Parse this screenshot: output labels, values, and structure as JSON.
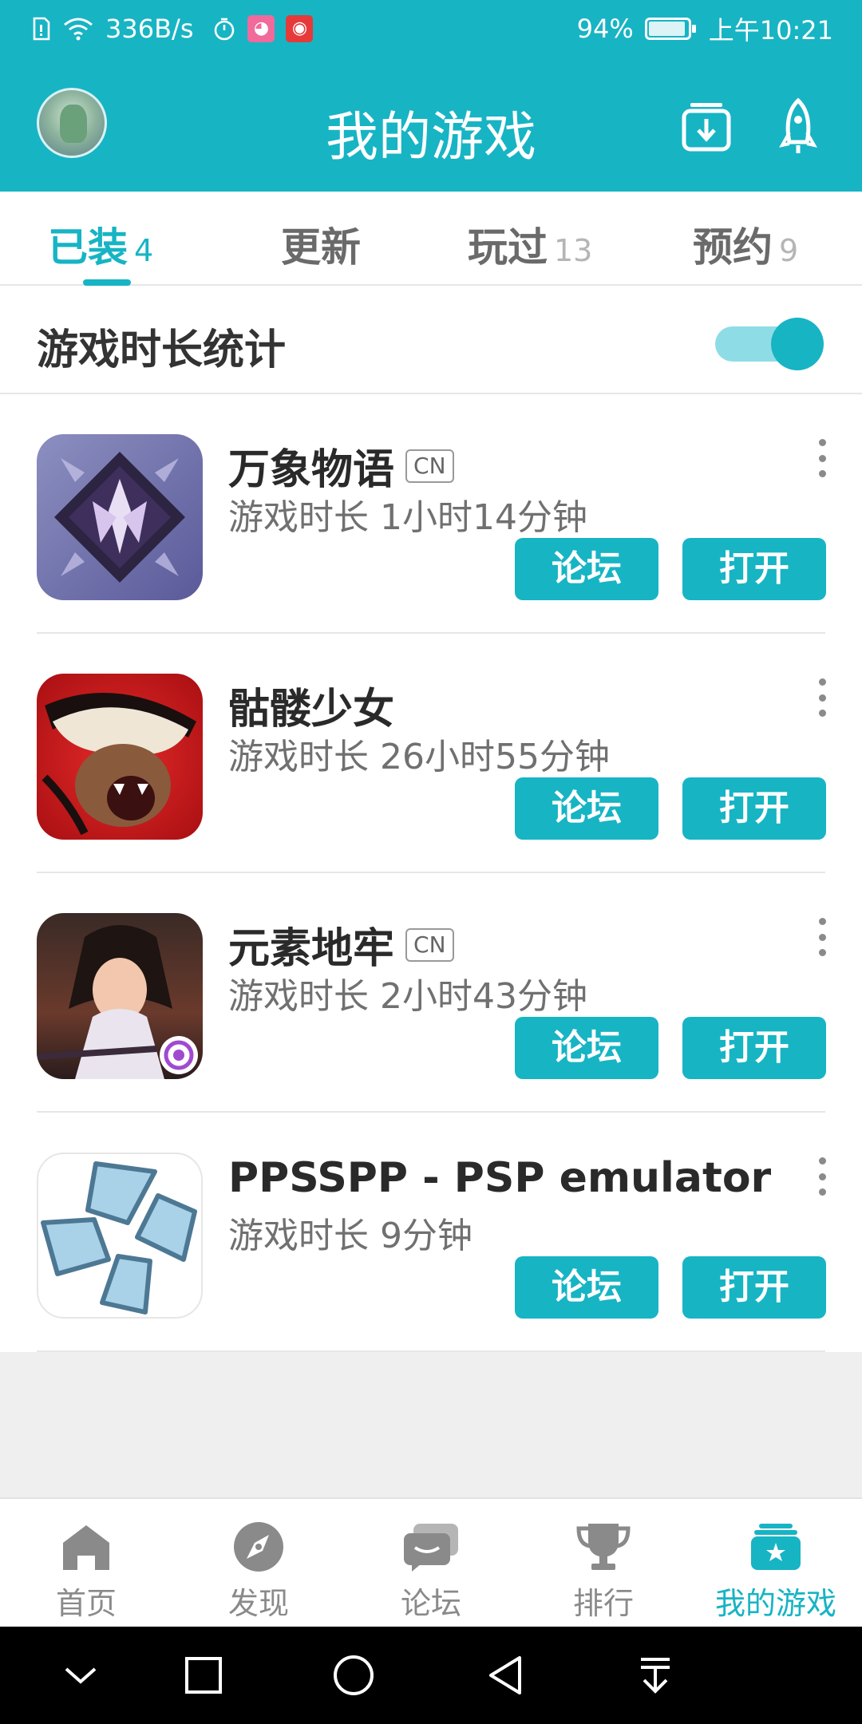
{
  "status_bar": {
    "net_speed": "336B/s",
    "battery_pct": "94%",
    "battery_level": 0.94,
    "time": "上午10:21",
    "icons": [
      "sim-icon",
      "wifi-icon",
      "timer-icon",
      "cat-app-icon",
      "music-app-icon"
    ]
  },
  "header": {
    "title": "我的游戏",
    "icons": [
      "avatar",
      "download-icon",
      "rocket-icon"
    ],
    "accent": "#17b4c4"
  },
  "tabs": [
    {
      "label": "已装",
      "count": "4",
      "active": true
    },
    {
      "label": "更新",
      "count": ""
    },
    {
      "label": "玩过",
      "count": "13"
    },
    {
      "label": "预约",
      "count": "9"
    }
  ],
  "stats": {
    "label": "游戏时长统计",
    "toggle_on": true
  },
  "games": [
    {
      "name": "万象物语",
      "tag": "CN",
      "time": "游戏时长 1小时14分钟",
      "forum": "论坛",
      "open": "打开",
      "icon": "sdorica-icon"
    },
    {
      "name": "骷髅少女",
      "tag": "",
      "time": "游戏时长 26小时55分钟",
      "forum": "论坛",
      "open": "打开",
      "icon": "skullgirls-icon"
    },
    {
      "name": "元素地牢",
      "tag": "CN",
      "time": "游戏时长 2小时43分钟",
      "forum": "论坛",
      "open": "打开",
      "icon": "elemental-dungeon-icon"
    },
    {
      "name": "PPSSPP - PSP emulator",
      "tag": "",
      "time": "游戏时长 9分钟",
      "forum": "论坛",
      "open": "打开",
      "icon": "ppsspp-icon"
    }
  ],
  "bottom_nav": [
    {
      "label": "首页",
      "icon": "home-icon"
    },
    {
      "label": "发现",
      "icon": "compass-icon"
    },
    {
      "label": "论坛",
      "icon": "forum-icon"
    },
    {
      "label": "排行",
      "icon": "trophy-icon"
    },
    {
      "label": "我的游戏",
      "icon": "my-games-icon",
      "active": true
    }
  ],
  "system_nav": [
    "collapse-icon",
    "recents-icon",
    "home-circle-icon",
    "back-icon",
    "pull-down-icon"
  ]
}
